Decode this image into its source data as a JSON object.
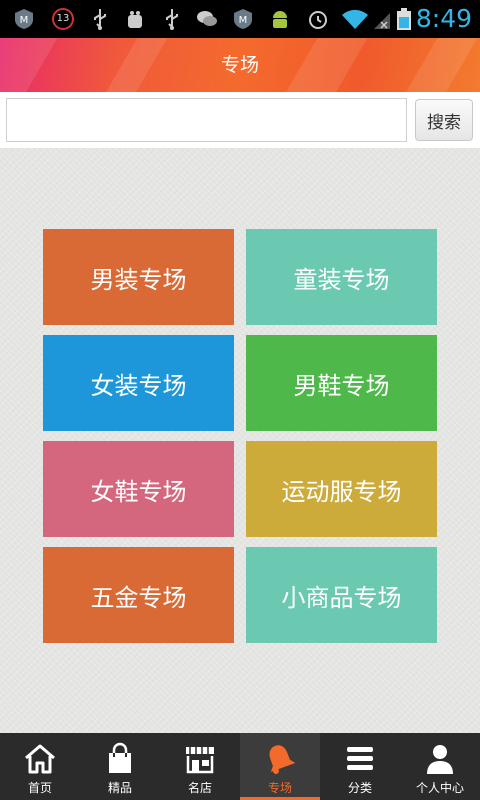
{
  "status_bar": {
    "time": "8:49",
    "notification_count": "13",
    "icons": [
      "m-app-icon",
      "counter-badge",
      "usb-icon",
      "android-debug-icon",
      "usb-icon",
      "wechat-icon",
      "m-app-icon",
      "android-icon",
      "alarm-icon",
      "wifi-icon",
      "no-signal-icon",
      "battery-icon"
    ]
  },
  "header": {
    "title": "专场"
  },
  "search": {
    "value": "",
    "placeholder": "",
    "button_label": "搜索"
  },
  "categories": [
    {
      "label": "男装专场",
      "color": "#da6a35"
    },
    {
      "label": "童装专场",
      "color": "#6bc8b1"
    },
    {
      "label": "女装专场",
      "color": "#1d96da"
    },
    {
      "label": "男鞋专场",
      "color": "#4fb84b"
    },
    {
      "label": "女鞋专场",
      "color": "#d4677e"
    },
    {
      "label": "运动服专场",
      "color": "#cdab3b"
    },
    {
      "label": "五金专场",
      "color": "#da6a35"
    },
    {
      "label": "小商品专场",
      "color": "#6bc8b1"
    }
  ],
  "bottom_nav": {
    "active_color": "#f26b2a",
    "items": [
      {
        "label": "首页",
        "icon": "home-icon"
      },
      {
        "label": "精品",
        "icon": "shopping-bag-icon"
      },
      {
        "label": "名店",
        "icon": "storefront-icon"
      },
      {
        "label": "专场",
        "icon": "bell-icon",
        "active": true
      },
      {
        "label": "分类",
        "icon": "menu-icon"
      },
      {
        "label": "个人中心",
        "icon": "user-icon"
      }
    ]
  }
}
